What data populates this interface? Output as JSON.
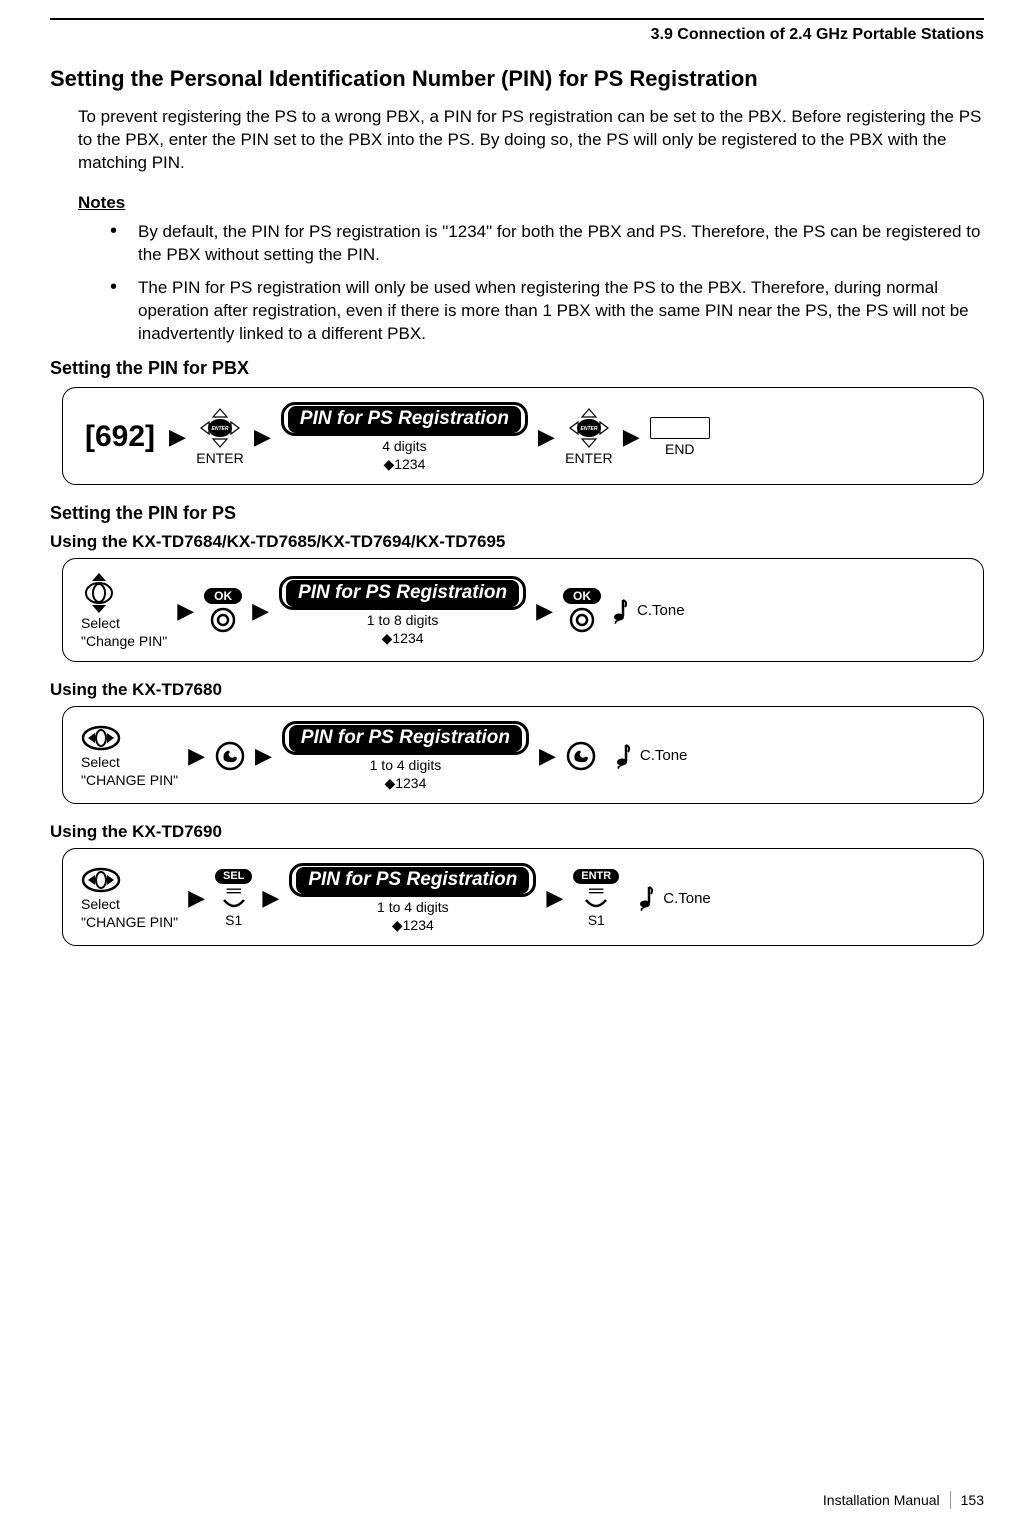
{
  "header": {
    "section": "3.9 Connection of 2.4 GHz Portable Stations"
  },
  "h1": "Setting the Personal Identification Number (PIN) for PS Registration",
  "intro": "To prevent registering the PS to a wrong PBX, a PIN for PS registration can be set to the PBX. Before registering the PS to the PBX, enter the PIN set to the PBX into the PS. By doing so, the PS will only be registered to the PBX with the matching PIN.",
  "notes_h": "Notes",
  "notes": [
    "By default, the PIN for PS registration is \"1234\" for both the PBX and PS. Therefore, the PS can be registered to the PBX without setting the PIN.",
    "The PIN for PS registration will only be used when registering the PS to the PBX. Therefore, during normal operation after registration, even if there is more than 1 PBX with the same PIN near the PS, the PS will not be inadvertently linked to a different PBX."
  ],
  "pbx": {
    "heading": "Setting the PIN for PBX",
    "code": "[692]",
    "enter": "ENTER",
    "pill": "PIN for PS Registration",
    "digits": "4 digits",
    "default": "◆1234",
    "end": "END"
  },
  "ps": {
    "heading": "Setting the PIN for PS",
    "models1": "Using the KX-TD7684/KX-TD7685/KX-TD7694/KX-TD7695",
    "flow1": {
      "select_line1": "Select",
      "select_line2": "\"Change PIN\"",
      "ok": "OK",
      "pill": "PIN for PS Registration",
      "digits": "1 to 8 digits",
      "default": "◆1234",
      "ctone": "C.Tone"
    },
    "models2": "Using the KX-TD7680",
    "flow2": {
      "select_line1": "Select",
      "select_line2": "\"CHANGE PIN\"",
      "pill": "PIN for PS Registration",
      "digits": "1 to 4 digits",
      "default": "◆1234",
      "ctone": "C.Tone"
    },
    "models3": "Using the KX-TD7690",
    "flow3": {
      "select_line1": "Select",
      "select_line2": "\"CHANGE PIN\"",
      "sel": "SEL",
      "s1a": "S1",
      "pill": "PIN for PS Registration",
      "digits": "1 to 4 digits",
      "default": "◆1234",
      "entr": "ENTR",
      "s1b": "S1",
      "ctone": "C.Tone"
    }
  },
  "footer": {
    "manual": "Installation Manual",
    "page": "153"
  },
  "icons": {
    "enter_key": "ENTER"
  }
}
